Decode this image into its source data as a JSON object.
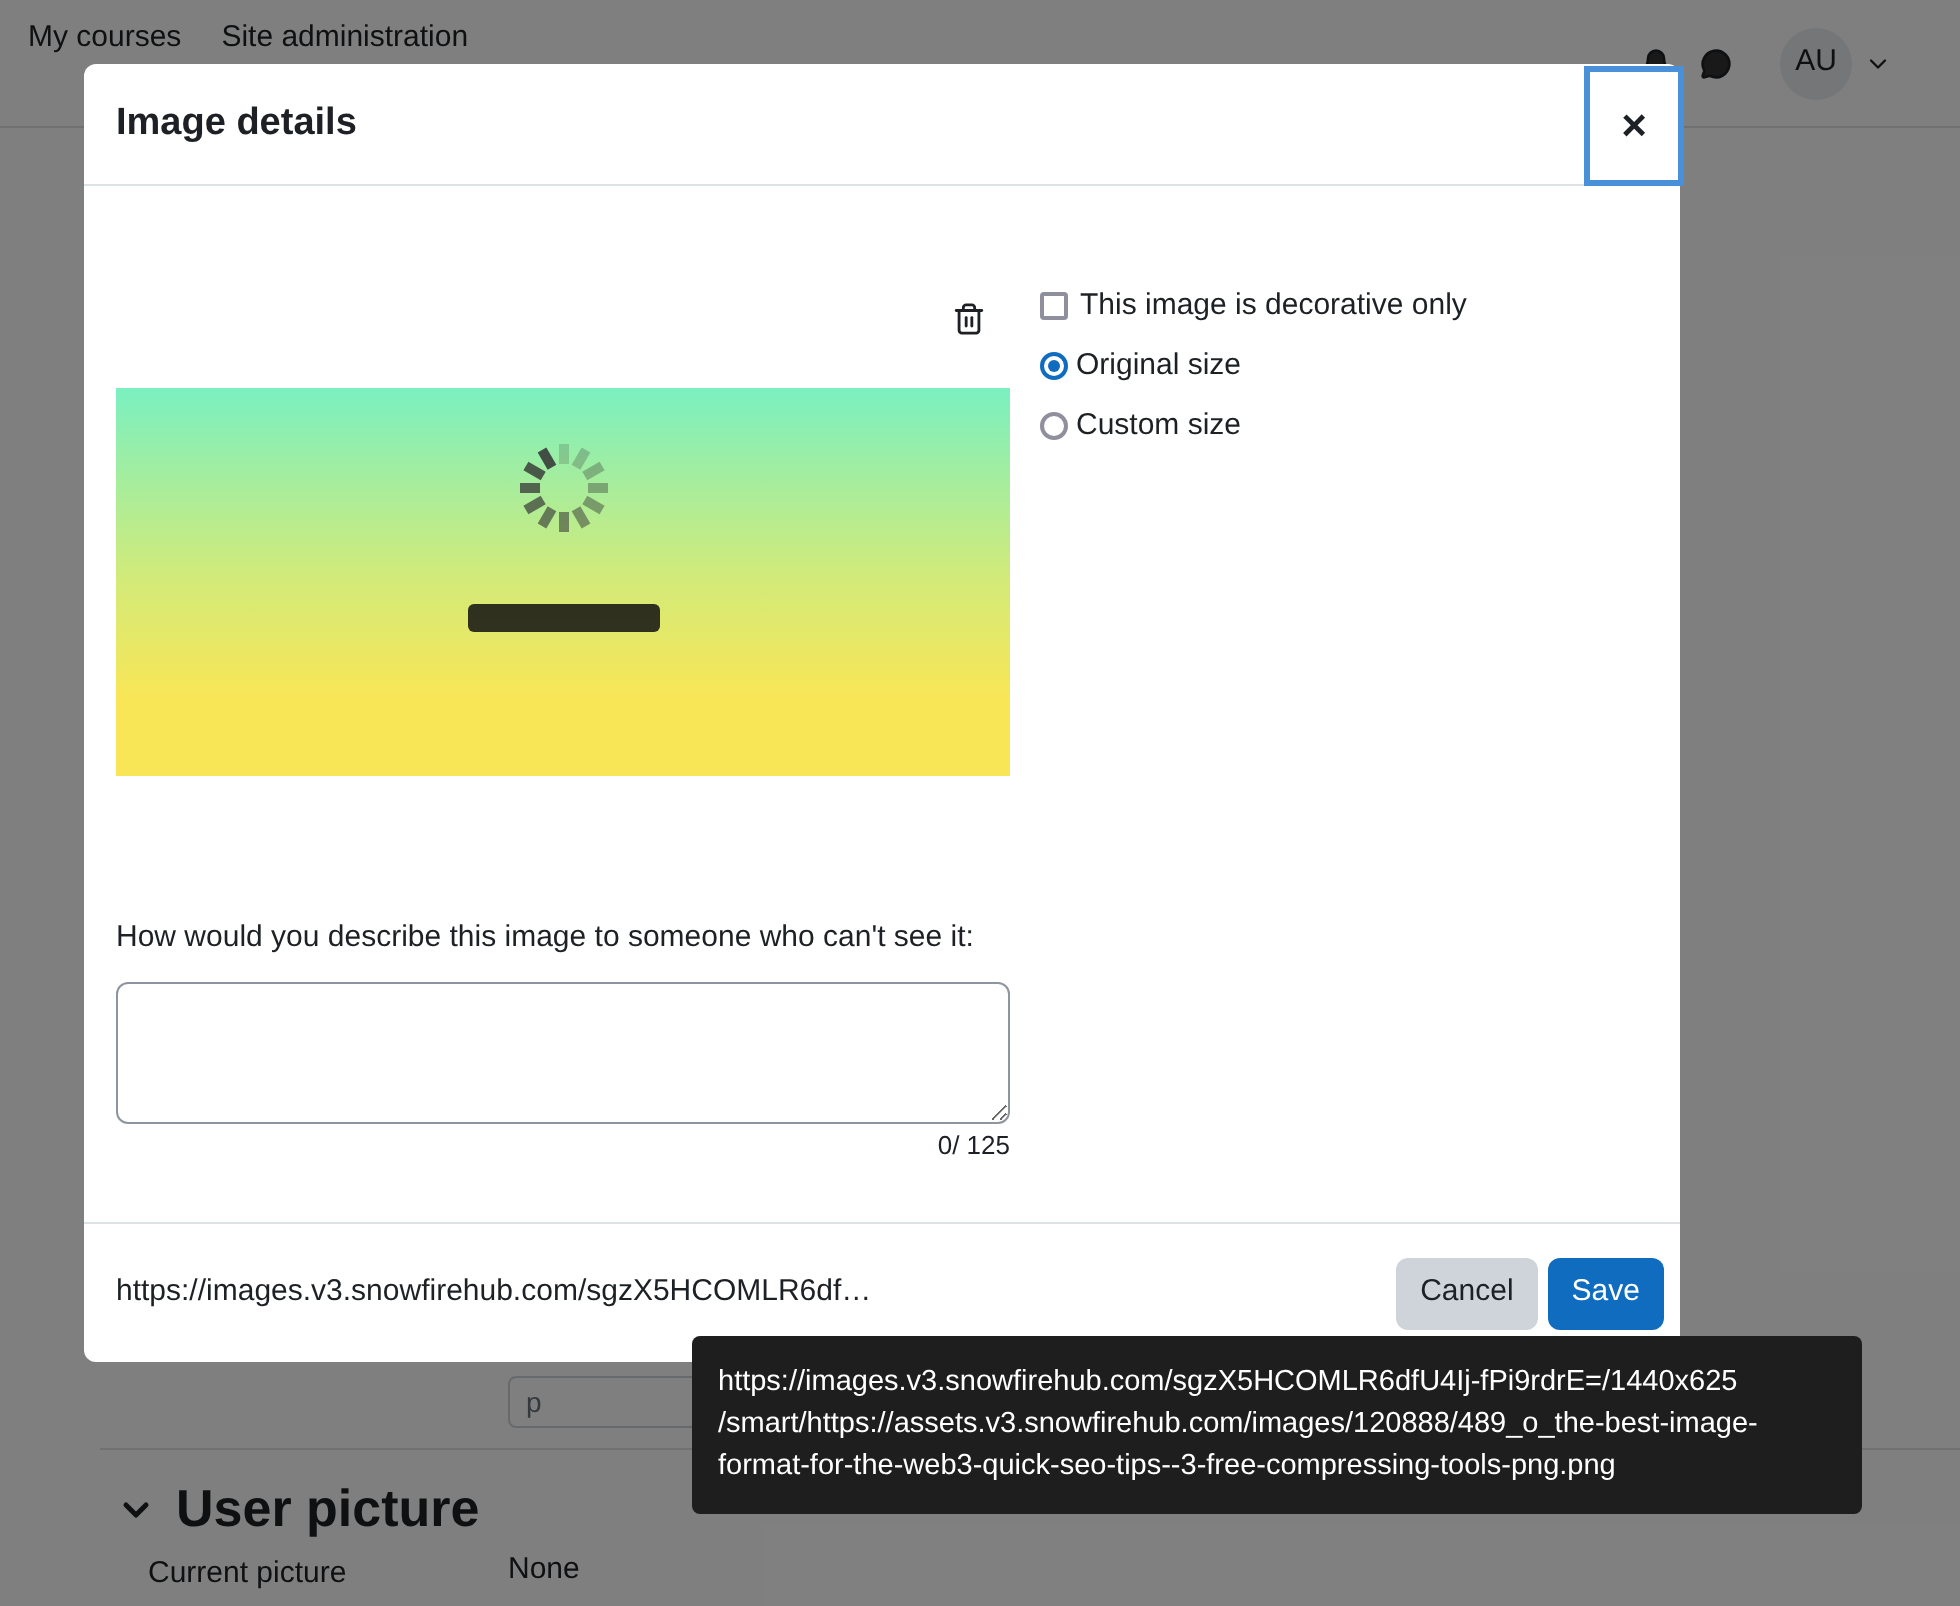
{
  "navbar": {
    "links": [
      "My courses",
      "Site administration"
    ],
    "avatar": "AU"
  },
  "background": {
    "field_value": "p",
    "section_title": "User picture",
    "rows": [
      {
        "label": "Current picture",
        "value": "None"
      }
    ]
  },
  "dialog": {
    "title": "Image details",
    "close": "×",
    "options": [
      {
        "kind": "checkbox",
        "label": "This image is decorative only",
        "checked": false
      },
      {
        "kind": "radio",
        "label": "Original size",
        "selected": true
      },
      {
        "kind": "radio",
        "label": "Custom size",
        "selected": false
      }
    ],
    "description": {
      "label": "How would you describe this image to someone who can't see it:",
      "counter": "0/ 125"
    },
    "url": "https://images.v3.snowfirehub.com/sgzX5HCOMLR6df…",
    "buttons": [
      {
        "label": "Cancel",
        "kind": "secondary"
      },
      {
        "label": "Save",
        "kind": "primary"
      }
    ]
  },
  "tooltip": {
    "lines": [
      "https://images.v3.snowfirehub.com/sgzX5HCOMLR6dfU4Ij-fPi9rdrE=/1440x625",
      "/smart/https://assets.v3.snowfirehub.com/images/120888/489_o_the-best-image-",
      "format-for-the-web3-quick-seo-tips--3-free-compressing-tools-png.png"
    ]
  }
}
